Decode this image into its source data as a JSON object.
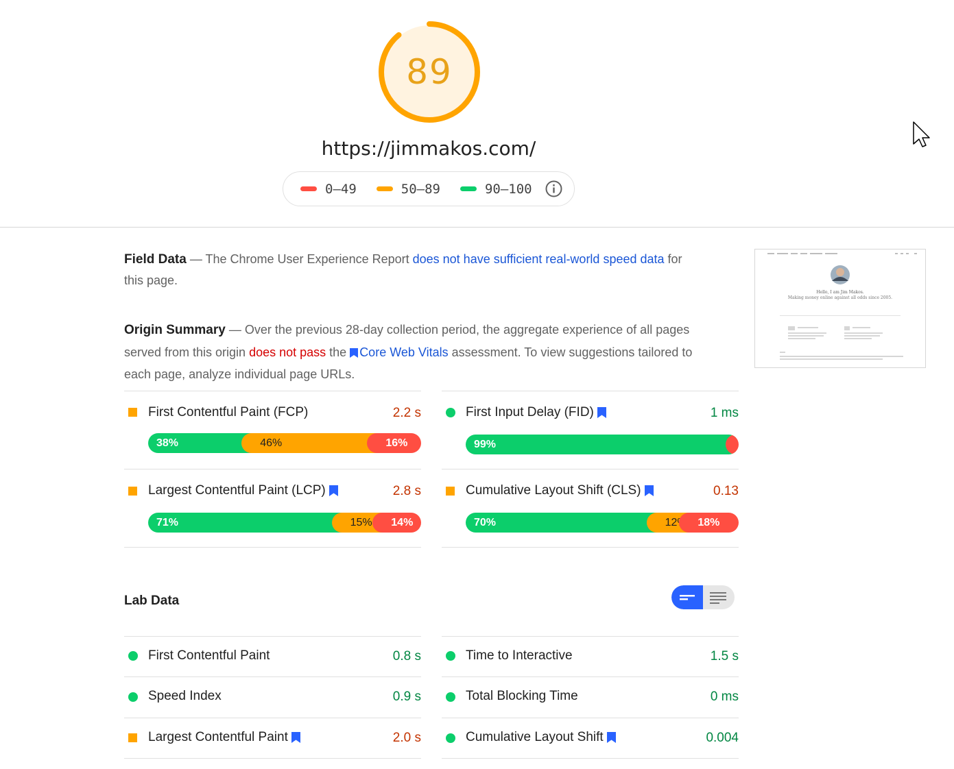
{
  "header": {
    "score": "89",
    "score_fraction": 0.89,
    "url": "https://jimmakos.com/",
    "legend": [
      {
        "label": "0–49",
        "color": "#ff4e42"
      },
      {
        "label": "50–89",
        "color": "#ffa400"
      },
      {
        "label": "90–100",
        "color": "#0cce6b"
      }
    ]
  },
  "field_data": {
    "heading": "Field Data",
    "text_before": " — The Chrome User Experience Report ",
    "link": "does not have sufficient real-world speed data",
    "text_after": " for this page."
  },
  "origin_summary": {
    "heading": "Origin Summary",
    "text_1": " — Over the previous 28-day collection period, the aggregate experience of all pages served from this origin ",
    "fail": "does not pass",
    "text_2": " the ",
    "link": "Core Web Vitals",
    "text_3": " assessment. To view suggestions tailored to each page, analyze individual page URLs."
  },
  "origin_metrics": [
    {
      "title": "First Contentful Paint (FCP)",
      "value": "2.2 s",
      "status": "average",
      "bookmark": false,
      "good": 38,
      "avg": 46,
      "poor": 16,
      "good_label": "38%",
      "avg_label": "46%",
      "poor_label": "16%"
    },
    {
      "title": "First Input Delay (FID)",
      "value": "1 ms",
      "status": "good",
      "bookmark": true,
      "good": 99,
      "avg": 0,
      "poor": 1,
      "good_label": "99%",
      "avg_label": "",
      "poor_label": "1%"
    },
    {
      "title": "Largest Contentful Paint (LCP)",
      "value": "2.8 s",
      "status": "average",
      "bookmark": true,
      "good": 71,
      "avg": 15,
      "poor": 14,
      "good_label": "71%",
      "avg_label": "15%",
      "poor_label": "14%"
    },
    {
      "title": "Cumulative Layout Shift (CLS)",
      "value": "0.13",
      "status": "average",
      "bookmark": true,
      "good": 70,
      "avg": 12,
      "poor": 18,
      "good_label": "70%",
      "avg_label": "12%",
      "poor_label": "18%"
    }
  ],
  "lab_data": {
    "heading": "Lab Data",
    "metrics": [
      {
        "title": "First Contentful Paint",
        "value": "0.8 s",
        "status": "good",
        "bookmark": false
      },
      {
        "title": "Time to Interactive",
        "value": "1.5 s",
        "status": "good",
        "bookmark": false
      },
      {
        "title": "Speed Index",
        "value": "0.9 s",
        "status": "good",
        "bookmark": false
      },
      {
        "title": "Total Blocking Time",
        "value": "0 ms",
        "status": "good",
        "bookmark": false
      },
      {
        "title": "Largest Contentful Paint",
        "value": "2.0 s",
        "status": "average",
        "bookmark": true
      },
      {
        "title": "Cumulative Layout Shift",
        "value": "0.004",
        "status": "good",
        "bookmark": true
      }
    ]
  },
  "screenshot": {
    "greeting": "Hello, I am Jim Makos.",
    "tagline": "Making money online against all odds since 2005."
  },
  "colors": {
    "good": "#0cce6b",
    "average": "#ffa400",
    "poor": "#ff4e42",
    "link": "#1a56d6"
  }
}
